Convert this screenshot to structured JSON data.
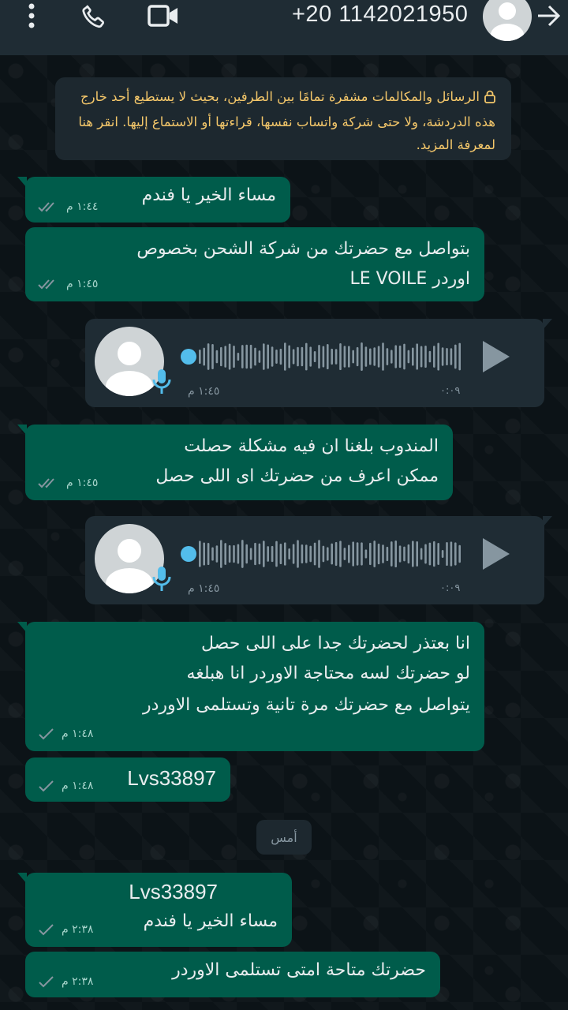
{
  "header": {
    "contact_name": "+20 1142021950",
    "icons": [
      "more-vert-icon",
      "phone-icon",
      "video-call-icon",
      "avatar",
      "back-arrow-icon"
    ]
  },
  "notice": {
    "text": "الرسائل والمكالمات مشفرة تمامًا بين الطرفين، بحيث لا يستطيع أحد خارج هذه الدردشة، ولا حتى شركة واتساب نفسها، قراءتها أو الاستماع إليها. انقر هنا لمعرفة المزيد."
  },
  "messages": [
    {
      "text": "مساء الخير يا فندم",
      "time": "١:٤٤ م"
    },
    {
      "lines": [
        "بتواصل مع حضرتك من شركة الشحن بخصوص",
        "اوردر LE VOILE"
      ],
      "time": "١:٤٥ م"
    },
    {
      "voice_duration": "٠:٠٩",
      "time": "١:٤٥ م"
    },
    {
      "lines": [
        "المندوب بلغنا ان فيه مشكلة حصلت",
        "ممكن اعرف من حضرتك اى اللى حصل"
      ],
      "time": "١:٤٥ م"
    },
    {
      "voice_duration": "٠:٠٩",
      "time": "١:٤٥ م"
    },
    {
      "lines": [
        "انا بعتذر لحضرتك  جدا على اللى حصل",
        "لو حضرتك لسه محتاجة الاوردر   انا هبلغه",
        "يتواصل مع حضرتك  مرة تانية وتستلمى الاوردر"
      ],
      "time": "١:٤٨ م"
    },
    {
      "text": "Lvs33897",
      "time": "١:٤٨ م"
    },
    {
      "lines": [
        "Lvs33897",
        "مساء الخير يا فندم"
      ],
      "time": "٢:٣٨ م"
    },
    {
      "text": "حضرتك متاحة امتى تستلمى الاوردر",
      "time": "٢:٣٨ م"
    }
  ],
  "date_separator": "أمس",
  "colors": {
    "outgoing_bubble": "#005c4b",
    "incoming_bubble": "#1f2c34",
    "header": "#1f2c34",
    "notice_text": "#f4c76a",
    "voice_dot": "#53bdeb"
  }
}
